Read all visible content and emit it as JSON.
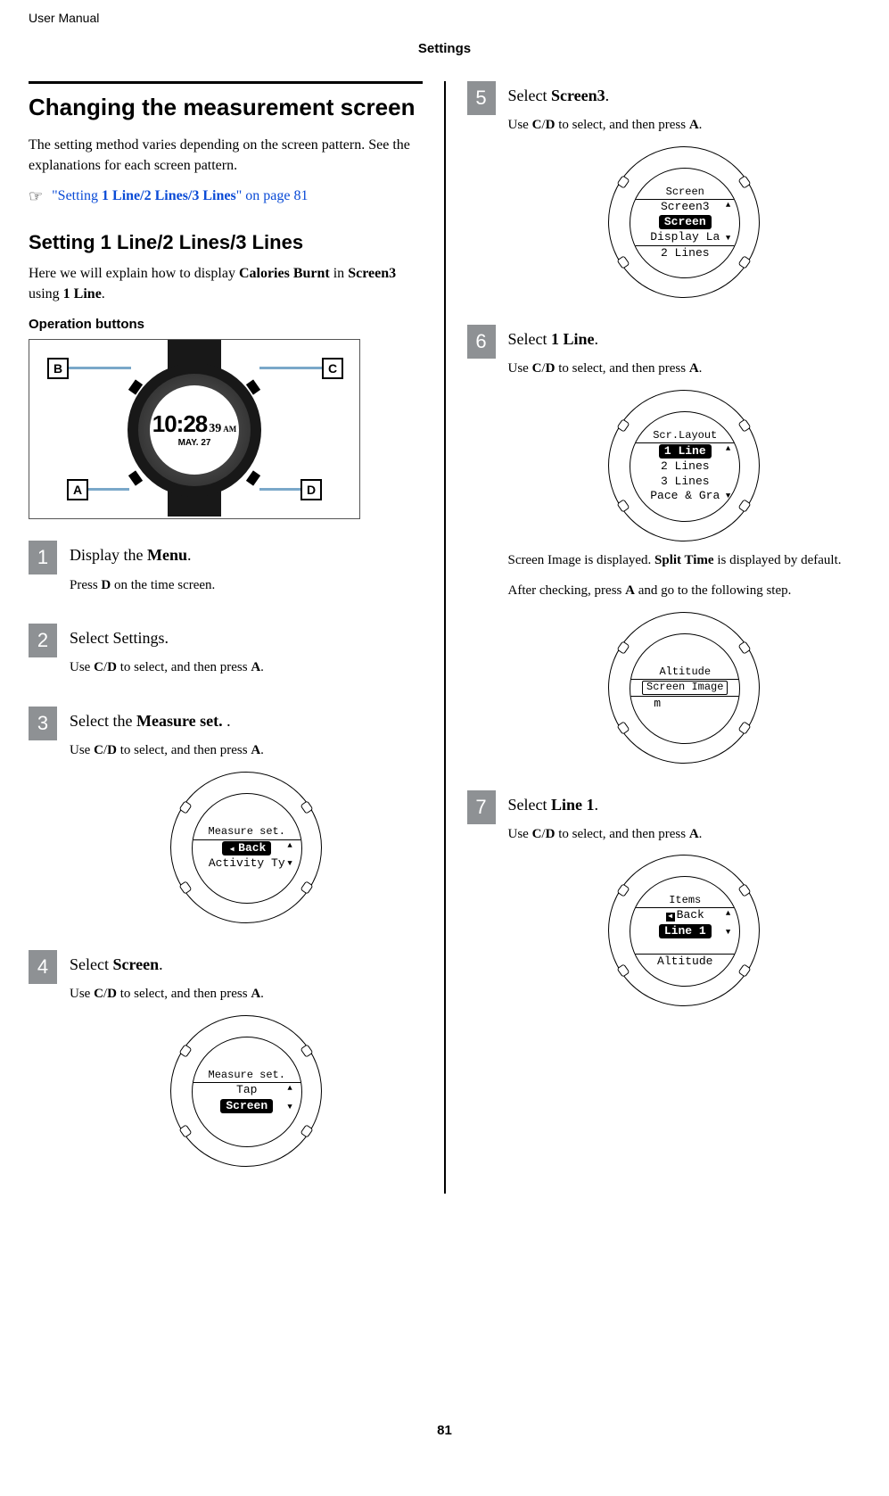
{
  "header": {
    "user_manual": "User Manual",
    "section": "Settings"
  },
  "left": {
    "title": "Changing the measurement screen",
    "intro": "The setting method varies depending on the screen pattern. See the explanations for each screen pattern.",
    "crossref_symbol": "☞",
    "crossref_pre": "\"Setting ",
    "crossref_bold": "1 Line/2 Lines/3 Lines",
    "crossref_post": "\" on page 81",
    "subheading": "Setting 1 Line/2 Lines/3 Lines",
    "subintro_1": "Here we will explain how to display ",
    "subintro_b1": "Calories Burnt",
    "subintro_2": " in ",
    "subintro_b2": "Screen3",
    "subintro_3": " using ",
    "subintro_b3": "1 Line",
    "subintro_4": ".",
    "op_buttons_label": "Operation buttons",
    "watch": {
      "label_A": "A",
      "label_B": "B",
      "label_C": "C",
      "label_D": "D",
      "time_main": "10:28",
      "time_sec": "39",
      "time_ampm": "AM",
      "date": "MAY. 27"
    },
    "steps": {
      "1": {
        "num": "1",
        "title_1": "Display the ",
        "title_b": "Menu",
        "title_2": ".",
        "sub_1": "Press ",
        "sub_b1": "D",
        "sub_2": " on the time screen."
      },
      "2": {
        "num": "2",
        "title": "Select Settings.",
        "sub_1": "Use ",
        "sub_b1": "C",
        "sub_slash": "/",
        "sub_b2": "D",
        "sub_2": " to select, and then press ",
        "sub_b3": "A",
        "sub_3": "."
      },
      "3": {
        "num": "3",
        "title_1": "Select the ",
        "title_b": "Measure set.",
        "title_2": " .",
        "sub_1": "Use ",
        "sub_b1": "C",
        "sub_slash": "/",
        "sub_b2": "D",
        "sub_2": " to select, and then press ",
        "sub_b3": "A",
        "sub_3": ".",
        "lcd": {
          "header": "Measure set.",
          "sel": "Back",
          "below": "Activity Ty"
        }
      },
      "4": {
        "num": "4",
        "title_1": "Select ",
        "title_b": "Screen",
        "title_2": ".",
        "sub_1": "Use ",
        "sub_b1": "C",
        "sub_slash": "/",
        "sub_b2": "D",
        "sub_2": " to select, and then press ",
        "sub_b3": "A",
        "sub_3": ".",
        "lcd": {
          "header": "Measure set.",
          "above": "Tap",
          "sel": "Screen"
        }
      }
    }
  },
  "right": {
    "steps": {
      "5": {
        "num": "5",
        "title_1": "Select ",
        "title_b": "Screen3",
        "title_2": ".",
        "sub_1": "Use ",
        "sub_b1": "C",
        "sub_slash": "/",
        "sub_b2": "D",
        "sub_2": " to select, and then press ",
        "sub_b3": "A",
        "sub_3": ".",
        "lcd": {
          "header": "Screen",
          "above": "Screen3",
          "sel": "Screen",
          "below": "Display La",
          "bottom": "2 Lines"
        }
      },
      "6": {
        "num": "6",
        "title_1": "Select ",
        "title_b": "1 Line",
        "title_2": ".",
        "sub_1": "Use ",
        "sub_b1": "C",
        "sub_slash": "/",
        "sub_b2": "D",
        "sub_2": " to select, and then press ",
        "sub_b3": "A",
        "sub_3": ".",
        "lcd": {
          "header": "Scr.Layout",
          "sel": "1 Line",
          "r2": "2 Lines",
          "r3": "3 Lines",
          "r4": "Pace & Gra"
        },
        "mid_1": "Screen Image is displayed. ",
        "mid_b1": "Split Time",
        "mid_2": " is displayed by default.",
        "mid2_1": "After checking, press ",
        "mid2_b1": "A",
        "mid2_2": " and go to the following step.",
        "lcd2": {
          "header": "Altitude",
          "sel": "Screen Image",
          "unit": "m"
        }
      },
      "7": {
        "num": "7",
        "title_1": "Select ",
        "title_b": "Line 1",
        "title_2": ".",
        "sub_1": "Use ",
        "sub_b1": "C",
        "sub_slash": "/",
        "sub_b2": "D",
        "sub_2": " to select, and then press ",
        "sub_b3": "A",
        "sub_3": ".",
        "lcd": {
          "header": "Items",
          "above": "Back",
          "sel": "Line 1",
          "bottom": "Altitude"
        }
      }
    }
  },
  "page_number": "81"
}
